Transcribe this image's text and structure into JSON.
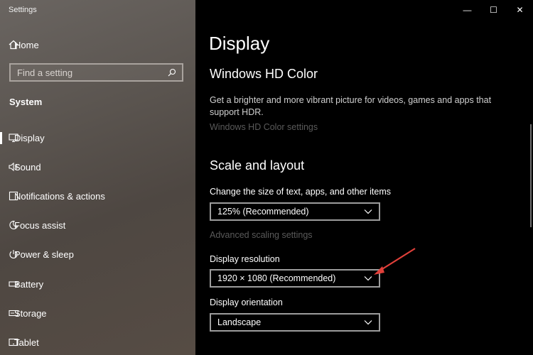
{
  "app": {
    "title": "Settings"
  },
  "sidebar": {
    "home_label": "Home",
    "search_placeholder": "Find a setting",
    "section": "System",
    "items": [
      {
        "label": "Display",
        "icon": "monitor-icon",
        "active": true
      },
      {
        "label": "Sound",
        "icon": "speaker-icon"
      },
      {
        "label": "Notifications & actions",
        "icon": "notification-icon"
      },
      {
        "label": "Focus assist",
        "icon": "moon-icon"
      },
      {
        "label": "Power & sleep",
        "icon": "power-icon"
      },
      {
        "label": "Battery",
        "icon": "battery-icon"
      },
      {
        "label": "Storage",
        "icon": "storage-icon"
      },
      {
        "label": "Tablet",
        "icon": "tablet-icon"
      }
    ]
  },
  "window_controls": {
    "minimize": "—",
    "maximize": "☐",
    "close": "✕"
  },
  "main": {
    "title": "Display",
    "hdr": {
      "heading": "Windows HD Color",
      "description": "Get a brighter and more vibrant picture for videos, games and apps that support HDR.",
      "link": "Windows HD Color settings"
    },
    "scale": {
      "heading": "Scale and layout",
      "size_label": "Change the size of text, apps, and other items",
      "size_value": "125% (Recommended)",
      "advanced_link": "Advanced scaling settings",
      "resolution_label": "Display resolution",
      "resolution_value": "1920 × 1080 (Recommended)",
      "orientation_label": "Display orientation",
      "orientation_value": "Landscape"
    }
  },
  "colors": {
    "annotation_arrow": "#e0403a"
  }
}
